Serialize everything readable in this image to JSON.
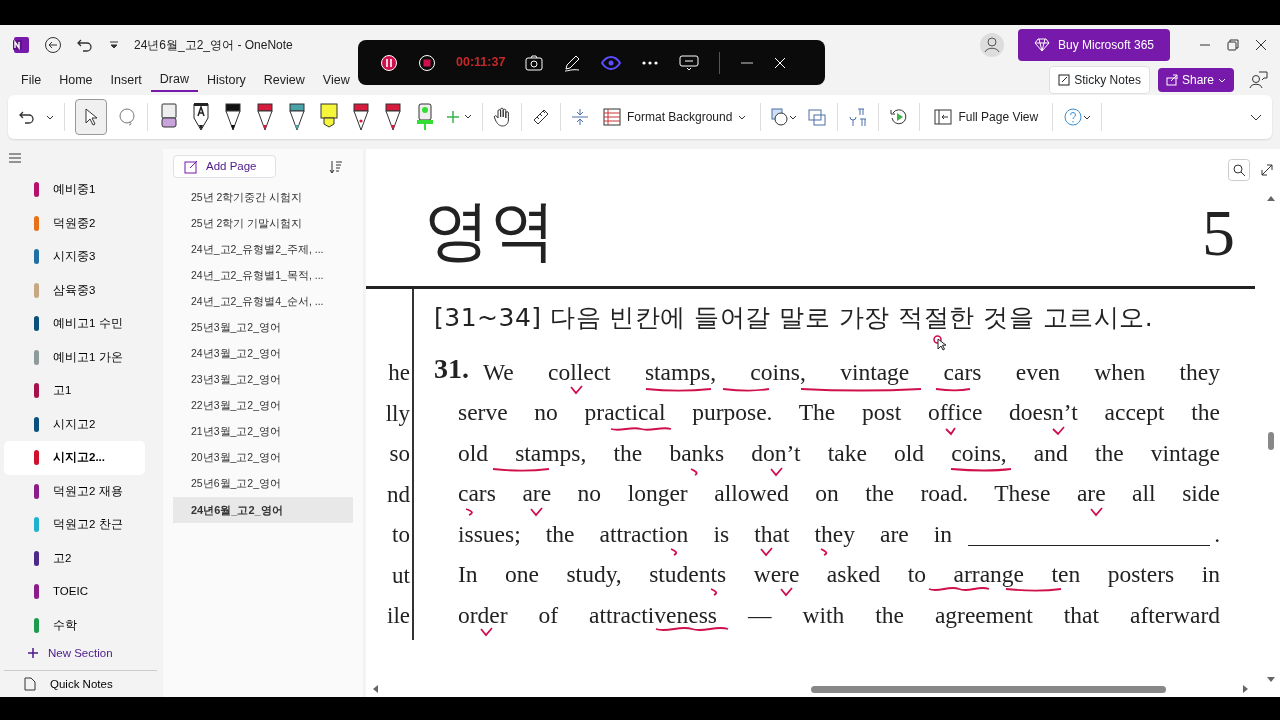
{
  "window": {
    "title": "24년6월_고2_영어 - OneNote",
    "buy_button": "Buy Microsoft 365"
  },
  "recorder": {
    "time": "00:11:37",
    "recording": true
  },
  "menu": [
    {
      "label": "File",
      "selected": false
    },
    {
      "label": "Home",
      "selected": false
    },
    {
      "label": "Insert",
      "selected": false
    },
    {
      "label": "Draw",
      "selected": true
    },
    {
      "label": "History",
      "selected": false
    },
    {
      "label": "Review",
      "selected": false
    },
    {
      "label": "View",
      "selected": false
    }
  ],
  "sticky_notes": "Sticky Notes",
  "share": "Share",
  "ribbon": {
    "select_active": true,
    "pens": [
      {
        "color": "#c9a4dc",
        "kind": "eraser"
      },
      {
        "color": "#222222",
        "kind": "text"
      },
      {
        "color": "#111111",
        "kind": "pen"
      },
      {
        "color": "#d81b3c",
        "kind": "pen"
      },
      {
        "color": "#4aa3a8",
        "kind": "pen"
      },
      {
        "color": "#f5f53a",
        "kind": "highlighter"
      },
      {
        "color": "#d81b3c",
        "kind": "fountain"
      },
      {
        "color": "#d81b3c",
        "kind": "pen"
      },
      {
        "color": "#33dd33",
        "kind": "marker"
      }
    ],
    "format_background": "Format Background",
    "full_page_view": "Full Page View"
  },
  "sections": [
    {
      "name": "예비중1",
      "color": "#b4116e",
      "selected": false
    },
    {
      "name": "덕원중2",
      "color": "#e8701a",
      "selected": false
    },
    {
      "name": "시지중3",
      "color": "#1f6fa3",
      "selected": false
    },
    {
      "name": "삼육중3",
      "color": "#c8a882",
      "selected": false
    },
    {
      "name": "예비고1 수민",
      "color": "#0b4f7c",
      "selected": false
    },
    {
      "name": "예비고1 가온",
      "color": "#8f9a9a",
      "selected": false
    },
    {
      "name": "고1",
      "color": "#a3124a",
      "selected": false
    },
    {
      "name": "시지고2",
      "color": "#0b4f7c",
      "selected": false
    },
    {
      "name": "시지고2...",
      "color": "#d0112b",
      "selected": true
    },
    {
      "name": "덕원고2 재용",
      "color": "#8b1d8b",
      "selected": false
    },
    {
      "name": "덕원고2 찬근",
      "color": "#22b0d0",
      "selected": false
    },
    {
      "name": "고2",
      "color": "#4b2a8a",
      "selected": false
    },
    {
      "name": "TOEIC",
      "color": "#8b1d8b",
      "selected": false
    },
    {
      "name": "수학",
      "color": "#1d9a4a",
      "selected": false
    }
  ],
  "new_section": "New Section",
  "quick_notes": "Quick Notes",
  "add_page": "Add Page",
  "pages": [
    {
      "title": "25년 2학기중간 시험지",
      "selected": false
    },
    {
      "title": "25년 2학기 기말시험지",
      "selected": false
    },
    {
      "title": "24년_고2_유형별2_주제, ...",
      "selected": false
    },
    {
      "title": "24년_고2_유형별1_목적, ...",
      "selected": false
    },
    {
      "title": "24년_고2_유형별4_순서, ...",
      "selected": false
    },
    {
      "title": "25년3월_고2_영어",
      "selected": false
    },
    {
      "title": "24년3월_고2_영어",
      "selected": false
    },
    {
      "title": "23년3월_고2_영어",
      "selected": false
    },
    {
      "title": "22년3월_고2_영어",
      "selected": false
    },
    {
      "title": "21년3월_고2_영어",
      "selected": false
    },
    {
      "title": "20년3월_고2_영어",
      "selected": false
    },
    {
      "title": "25년6월_고2_영어",
      "selected": false
    },
    {
      "title": "24년6월_고2_영어",
      "selected": true
    }
  ],
  "document": {
    "header": "영역",
    "page_number": "5",
    "margin_fragments": [
      "he",
      "lly",
      "so",
      "nd",
      "to",
      "ut",
      "ile"
    ],
    "instruction": "[31~34] 다음 빈칸에 들어갈 말로 가장 적절한 것을 고르시오.",
    "question_number": "31.",
    "lines": [
      {
        "kind": "plain",
        "text": "We collect stamps, coins, vintage cars even when they"
      },
      {
        "kind": "plain",
        "text": "serve no practical purpose. The post office doesn’t accept the"
      },
      {
        "kind": "plain",
        "text": "old stamps, the banks don’t take old coins, and the vintage"
      },
      {
        "kind": "plain",
        "text": "cars are no longer allowed on the road. These are all side"
      },
      {
        "kind": "blank",
        "text": "issues; the attraction is that they are in"
      },
      {
        "kind": "plain",
        "text": "In one study, students were asked to arrange ten posters in"
      },
      {
        "kind": "plain",
        "text": "order of attractiveness — with the agreement that afterward"
      }
    ],
    "blank_end": "."
  }
}
